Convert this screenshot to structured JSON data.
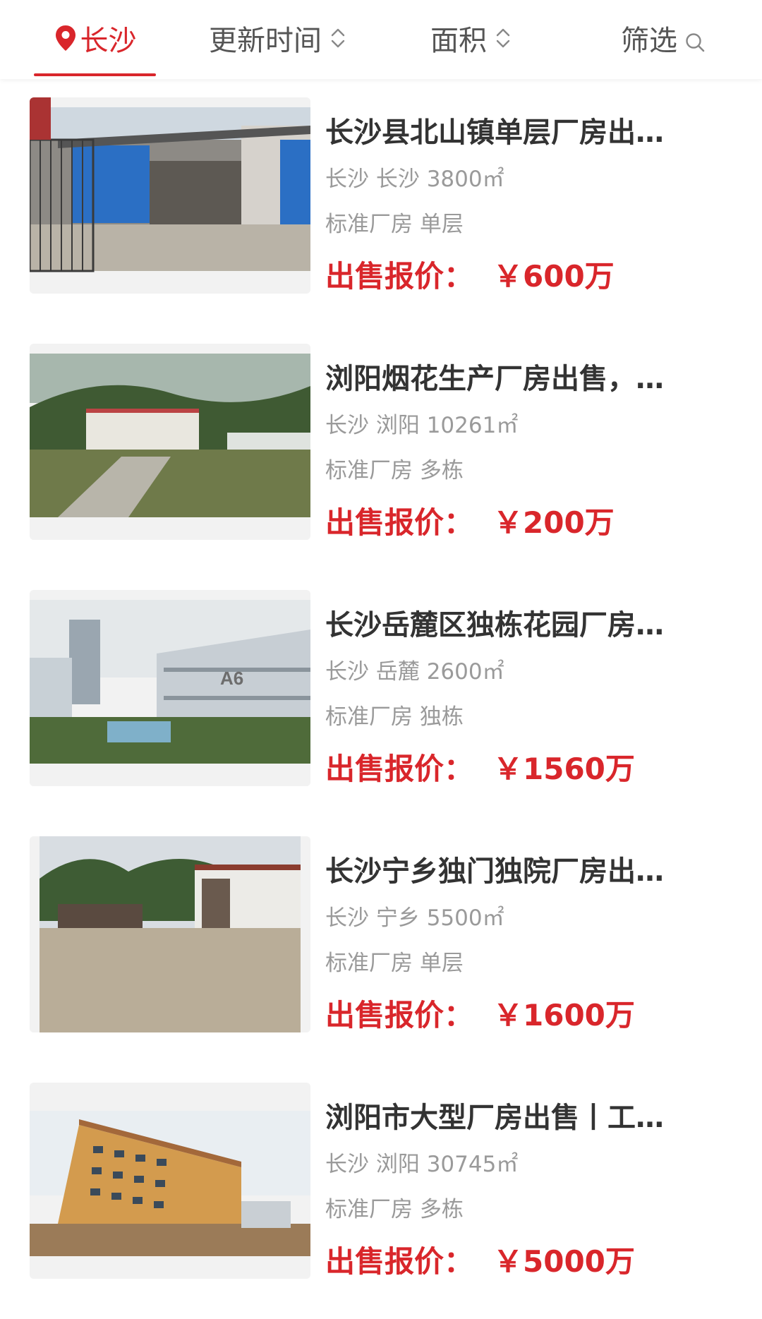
{
  "filter_bar": {
    "city": "长沙",
    "update_time": "更新时间",
    "area": "面积",
    "filter": "筛选",
    "accent_color": "#d9262b"
  },
  "price_prefix": "出售报价：",
  "listings": [
    {
      "title": "长沙县北山镇单层厂房出…",
      "location": "长沙 长沙 3800㎡",
      "type": "标准厂房 单层",
      "price": "￥600万"
    },
    {
      "title": "浏阳烟花生产厂房出售，…",
      "location": "长沙 浏阳 10261㎡",
      "type": "标准厂房 多栋",
      "price": "￥200万"
    },
    {
      "title": "长沙岳麓区独栋花园厂房…",
      "location": "长沙 岳麓 2600㎡",
      "type": "标准厂房 独栋",
      "price": "￥1560万"
    },
    {
      "title": "长沙宁乡独门独院厂房出…",
      "location": "长沙 宁乡 5500㎡",
      "type": "标准厂房 单层",
      "price": "￥1600万"
    },
    {
      "title": "浏阳市大型厂房出售丨工…",
      "location": "长沙 浏阳 30745㎡",
      "type": "标准厂房 多栋",
      "price": "￥5000万"
    }
  ]
}
